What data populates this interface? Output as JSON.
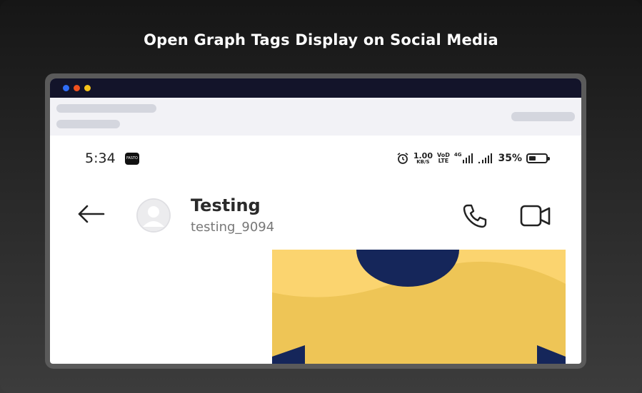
{
  "headline": "Open Graph Tags Display on Social Media",
  "status": {
    "time": "5:34",
    "app_badge": "FASTO",
    "speed_value": "1.00",
    "speed_unit": "KB/S",
    "volte_top": "VoD",
    "volte_bottom": "LTE",
    "network": "4G",
    "battery": "35%"
  },
  "chat": {
    "contact_name": "Testing",
    "contact_handle": "testing_9094"
  },
  "colors": {
    "preview_yellow": "#eec556",
    "preview_light_yellow": "#fbd46f",
    "preview_navy": "#15265a",
    "titlebar": "#13142a"
  },
  "icons": [
    "alarm-icon",
    "back-arrow-icon",
    "avatar-icon",
    "phone-call-icon",
    "video-call-icon",
    "signal-icon",
    "battery-icon"
  ]
}
